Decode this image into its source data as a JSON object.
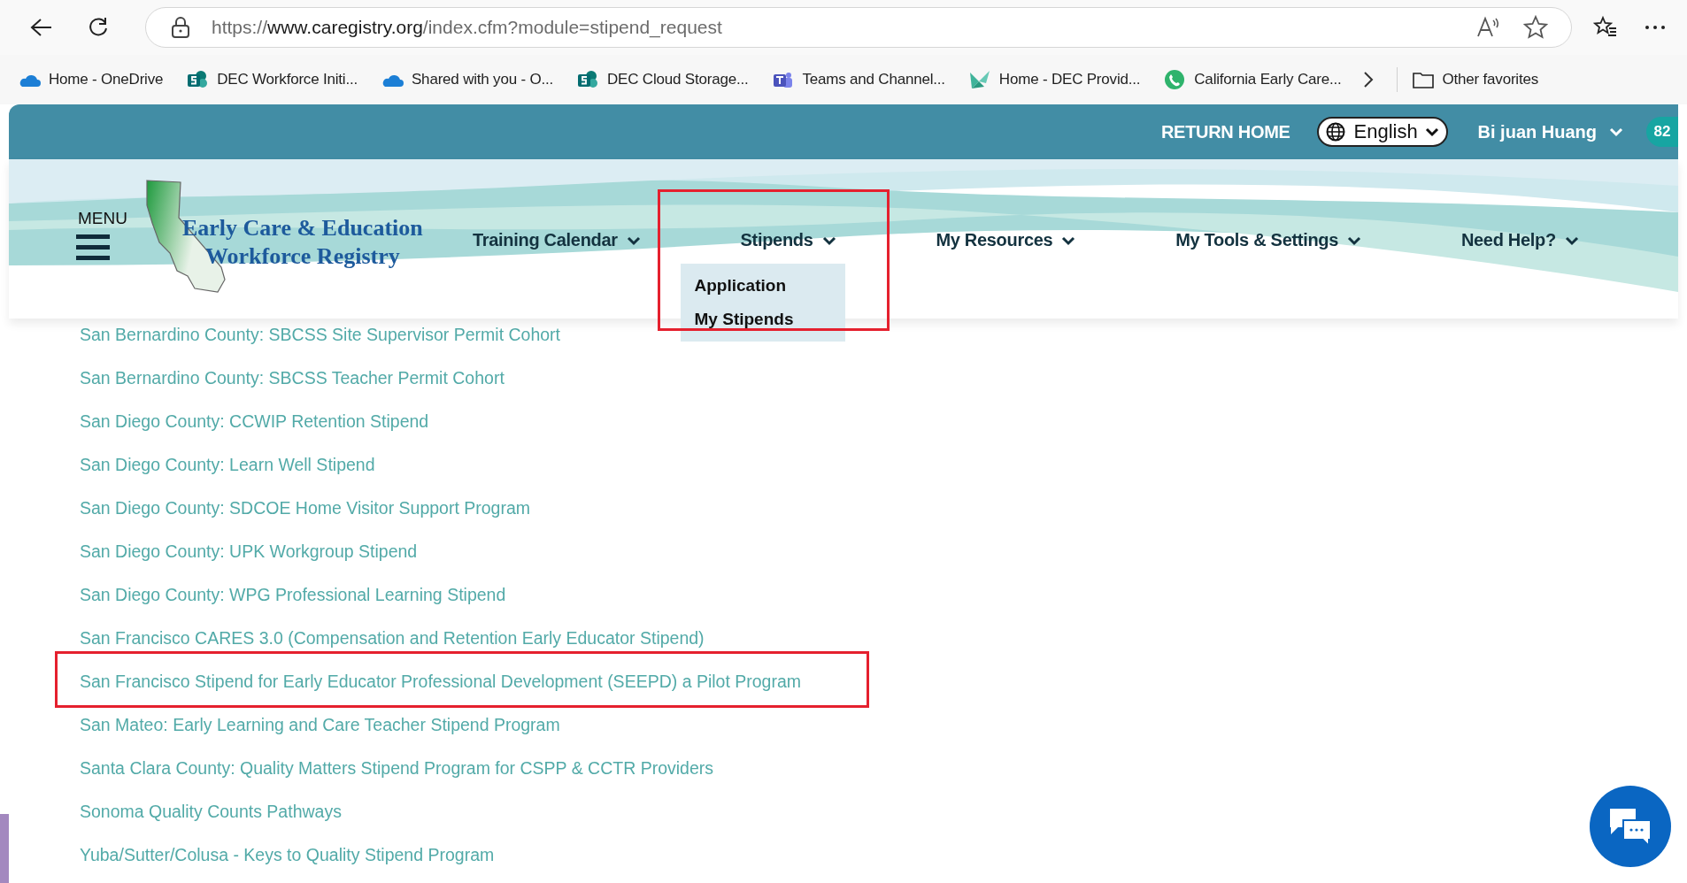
{
  "browser": {
    "url": {
      "scheme": "https://",
      "domain": "www.caregistry.org",
      "path": "/index.cfm?module=stipend_request"
    },
    "bookmarks": [
      {
        "label": "Home - OneDrive",
        "kind": "cloud"
      },
      {
        "label": "DEC Workforce Initi...",
        "kind": "sharepoint"
      },
      {
        "label": "Shared with you - O...",
        "kind": "cloud"
      },
      {
        "label": "DEC Cloud Storage...",
        "kind": "sharepoint"
      },
      {
        "label": "Teams and Channel...",
        "kind": "teams"
      },
      {
        "label": "Home - DEC Provid...",
        "kind": "origami"
      },
      {
        "label": "California Early Care...",
        "kind": "phone"
      }
    ],
    "other_favorites": "Other favorites"
  },
  "top_bar": {
    "return_home": "RETURN HOME",
    "language": "English",
    "user": "Bi juan Huang",
    "badge": "82"
  },
  "header": {
    "menu_label": "MENU",
    "logo_lines": [
      "Early Care & Education",
      "Workforce Registry"
    ],
    "nav": [
      {
        "label": "Training Calendar",
        "highlighted": false
      },
      {
        "label": "Stipends",
        "highlighted": true,
        "items": [
          "Application",
          "My Stipends"
        ]
      },
      {
        "label": "My Resources",
        "highlighted": false
      },
      {
        "label": "My Tools & Settings",
        "highlighted": false
      },
      {
        "label": "Need Help?",
        "highlighted": false
      }
    ]
  },
  "stipend_links": [
    {
      "label": "San Bernardino County: SBCSS Site Supervisor Permit Cohort",
      "highlighted": false
    },
    {
      "label": "San Bernardino County: SBCSS Teacher Permit Cohort",
      "highlighted": false
    },
    {
      "label": "San Diego County: CCWIP Retention Stipend",
      "highlighted": false
    },
    {
      "label": "San Diego County: Learn Well Stipend",
      "highlighted": false
    },
    {
      "label": "San Diego County: SDCOE Home Visitor Support Program",
      "highlighted": false
    },
    {
      "label": "San Diego County: UPK Workgroup Stipend",
      "highlighted": false
    },
    {
      "label": "San Diego County: WPG Professional Learning Stipend",
      "highlighted": false
    },
    {
      "label": "San Francisco CARES 3.0 (Compensation and Retention Early Educator Stipend)",
      "highlighted": false
    },
    {
      "label": "San Francisco Stipend for Early Educator Professional Development (SEEPD) a Pilot Program",
      "highlighted": true
    },
    {
      "label": "San Mateo: Early Learning and Care Teacher Stipend Program",
      "highlighted": false
    },
    {
      "label": "Santa Clara County: Quality Matters Stipend Program for CSPP & CCTR Providers",
      "highlighted": false
    },
    {
      "label": "Sonoma Quality Counts Pathways",
      "highlighted": false
    },
    {
      "label": "Yuba/Sutter/Colusa - Keys to Quality Stipend Program",
      "highlighted": false
    }
  ]
}
